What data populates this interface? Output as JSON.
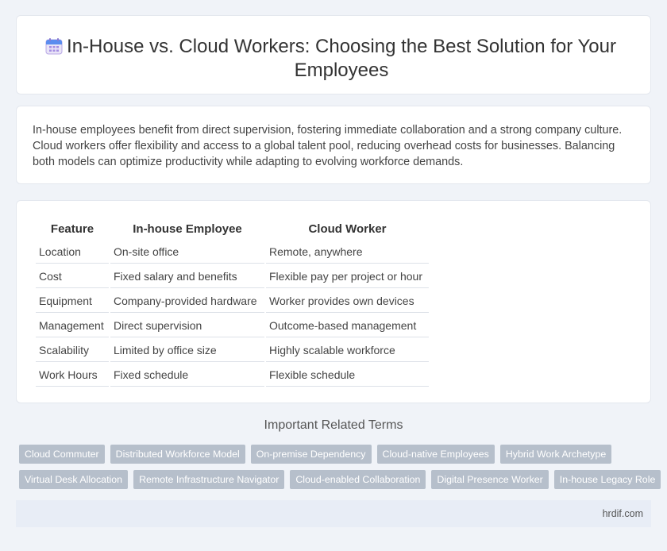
{
  "header": {
    "icon": "calendar-icon",
    "title": "In-House vs. Cloud Workers: Choosing the Best Solution for Your Employees"
  },
  "intro": {
    "text": "In-house employees benefit from direct supervision, fostering immediate collaboration and a strong company culture. Cloud workers offer flexibility and access to a global talent pool, reducing overhead costs for businesses. Balancing both models can optimize productivity while adapting to evolving workforce demands."
  },
  "table": {
    "headers": [
      "Feature",
      "In-house Employee",
      "Cloud Worker"
    ],
    "rows": [
      [
        "Location",
        "On-site office",
        "Remote, anywhere"
      ],
      [
        "Cost",
        "Fixed salary and benefits",
        "Flexible pay per project or hour"
      ],
      [
        "Equipment",
        "Company-provided hardware",
        "Worker provides own devices"
      ],
      [
        "Management",
        "Direct supervision",
        "Outcome-based management"
      ],
      [
        "Scalability",
        "Limited by office size",
        "Highly scalable workforce"
      ],
      [
        "Work Hours",
        "Fixed schedule",
        "Flexible schedule"
      ]
    ]
  },
  "related": {
    "title": "Important Related Terms",
    "row1": [
      "Cloud Commuter",
      "Distributed Workforce Model",
      "On-premise Dependency",
      "Cloud-native Employees",
      "Hybrid Work Archetype"
    ],
    "row2": [
      "Virtual Desk Allocation",
      "Remote Infrastructure Navigator",
      "Cloud-enabled Collaboration",
      "Digital Presence Worker",
      "In-house Legacy Role"
    ]
  },
  "footer": {
    "site": "hrdif.com"
  }
}
